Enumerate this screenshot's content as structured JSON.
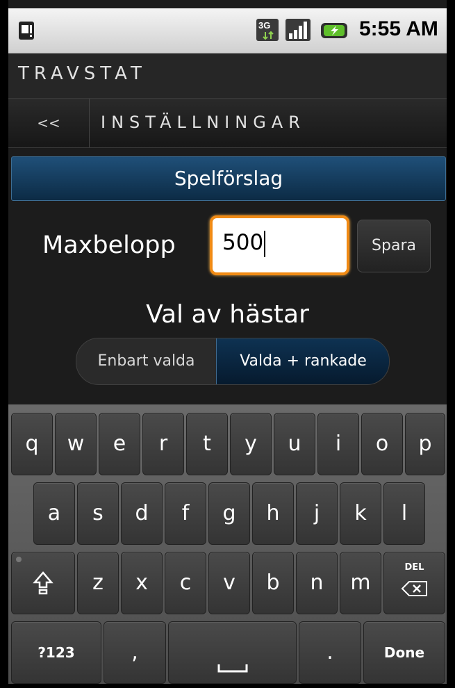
{
  "status_bar": {
    "time": "5:55 AM",
    "network_badge": "3G",
    "icons": [
      "sim-alert-icon",
      "network-3g-icon",
      "signal-strength-icon",
      "battery-charging-icon"
    ]
  },
  "app": {
    "title": "TRAVSTAT"
  },
  "nav": {
    "back_label": "<<",
    "title": "INSTÄLLNINGAR"
  },
  "section": {
    "title": "Spelförslag"
  },
  "maxbelopp": {
    "label": "Maxbelopp",
    "value": "500",
    "save_label": "Spara"
  },
  "horse_selection": {
    "label": "Val av hästar",
    "options": [
      "Enbart valda",
      "Valda + rankade"
    ],
    "selected": "Valda + rankade"
  },
  "keyboard": {
    "row1": [
      "q",
      "w",
      "e",
      "r",
      "t",
      "y",
      "u",
      "i",
      "o",
      "p"
    ],
    "row2": [
      "a",
      "s",
      "d",
      "f",
      "g",
      "h",
      "j",
      "k",
      "l"
    ],
    "row3": [
      "z",
      "x",
      "c",
      "v",
      "b",
      "n",
      "m"
    ],
    "shift_icon": "shift-icon",
    "del_label": "DEL",
    "symbols_label": "?123",
    "comma_label": ",",
    "period_label": ".",
    "done_label": "Done"
  },
  "colors": {
    "accent_focus": "#f08a14",
    "section_header": "#1f4f78",
    "segment_selected": "#0e3252"
  }
}
